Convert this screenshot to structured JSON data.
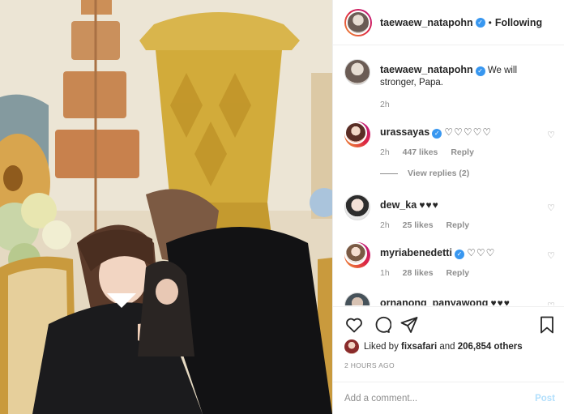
{
  "post": {
    "author": "taewaew_natapohn",
    "follow_state": "Following",
    "caption_user": "taewaew_natapohn",
    "caption": "We will stronger, Papa.",
    "caption_time": "2h"
  },
  "comments": [
    {
      "user": "urassayas",
      "text": "♡♡♡♡♡",
      "time": "2h",
      "likes": "447 likes",
      "reply": "Reply",
      "verified": true
    },
    {
      "user": "dew_ka",
      "text": "♥♥♥",
      "time": "2h",
      "likes": "25 likes",
      "reply": "Reply",
      "verified": false
    },
    {
      "user": "myriabenedetti",
      "text": "♡♡♡",
      "time": "1h",
      "likes": "28 likes",
      "reply": "Reply",
      "verified": true
    },
    {
      "user": "ornanong_panyawong",
      "text": "♥♥♥",
      "verified": false
    }
  ],
  "view_replies": "View replies (2)",
  "liked_by": {
    "prefix": "Liked by",
    "user": "fixsafari",
    "middle": "and",
    "count": "206,854 others"
  },
  "timestamp": "2 HOURS AGO",
  "comment_box": {
    "placeholder": "Add a comment...",
    "post_label": "Post"
  },
  "icons": {
    "like": "heart-icon",
    "comment": "comment-icon",
    "share": "paper-plane-icon",
    "save": "bookmark-icon",
    "more": "more-options-icon",
    "verified": "verified-badge-icon"
  },
  "colors": {
    "verified": "#3897f0",
    "heart_red": "#ed4956",
    "post_button": "#b2dffc",
    "meta_gray": "#8e8e8e"
  }
}
